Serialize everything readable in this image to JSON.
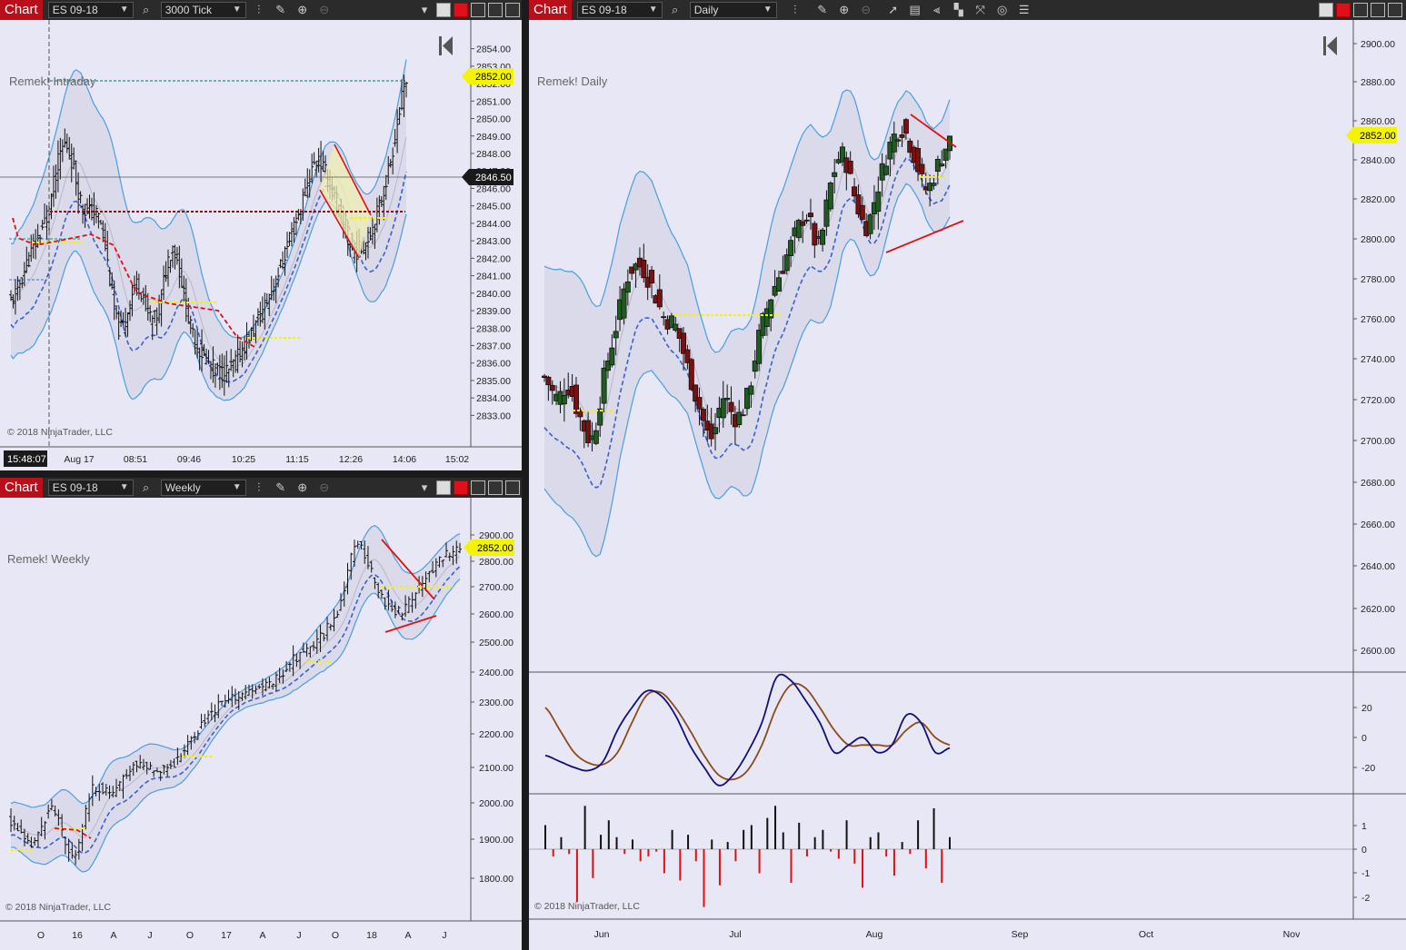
{
  "panels": {
    "intraday": {
      "tag": "Chart",
      "instrument": "ES 09-18",
      "period": "3000 Tick",
      "label": "Remek! Intraday",
      "copyright": "© 2018 NinjaTrader, LLC",
      "time_box": "15:48:07",
      "price_tag": "2852.00",
      "crosshair_tag": "2846.50",
      "x_labels": [
        "Aug 17",
        "08:51",
        "09:46",
        "10:25",
        "11:15",
        "12:26",
        "14:06",
        "15:02"
      ],
      "y_labels": [
        "2854.00",
        "2853.00",
        "2852.00",
        "2851.00",
        "2850.00",
        "2849.00",
        "2848.00",
        "2847.00",
        "2846.00",
        "2845.00",
        "2844.00",
        "2843.00",
        "2842.00",
        "2841.00",
        "2840.00",
        "2839.00",
        "2838.00",
        "2837.00",
        "2836.00",
        "2835.00",
        "2834.00",
        "2833.00"
      ]
    },
    "weekly": {
      "tag": "Chart",
      "instrument": "ES 09-18",
      "period": "Weekly",
      "label": "Remek! Weekly",
      "copyright": "© 2018 NinjaTrader, LLC",
      "price_tag": "2852.00",
      "x_labels": [
        "O",
        "16",
        "A",
        "J",
        "O",
        "17",
        "A",
        "J",
        "O",
        "18",
        "A",
        "J"
      ],
      "y_labels": [
        "2900.00",
        "2800.00",
        "2700.00",
        "2600.00",
        "2500.00",
        "2400.00",
        "2300.00",
        "2200.00",
        "2100.00",
        "2000.00",
        "1900.00",
        "1800.00"
      ]
    },
    "daily": {
      "tag": "Chart",
      "instrument": "ES 09-18",
      "period": "Daily",
      "label": "Remek! Daily",
      "copyright": "© 2018 NinjaTrader, LLC",
      "price_tag": "2852.00",
      "x_labels": [
        "Jun",
        "Jul",
        "Aug",
        "Sep",
        "Oct",
        "Nov"
      ],
      "y_labels": [
        "2900.00",
        "2880.00",
        "2860.00",
        "2840.00",
        "2820.00",
        "2800.00",
        "2780.00",
        "2760.00",
        "2740.00",
        "2720.00",
        "2700.00",
        "2680.00",
        "2660.00",
        "2640.00",
        "2620.00",
        "2600.00"
      ],
      "osc_labels": [
        "20",
        "0",
        "-20"
      ],
      "hist_labels": [
        "1",
        "0",
        "-1",
        "-2"
      ]
    }
  },
  "colors": {
    "bg": "#e8e7f5",
    "band": "#d6d5e6",
    "band_line": "#4a9ee0",
    "mid_line": "#3a5fcf",
    "red_line": "#e01010",
    "dark_red": "#8b1010",
    "yellow": "#f4f400",
    "up_candle": "#1f5c1f",
    "down_candle": "#7a1010",
    "teal": "#1d8f8f",
    "osc_fast": "#10107a",
    "osc_slow": "#8b4a1a"
  },
  "chart_data": [
    {
      "type": "candlestick",
      "title": "Remek! Intraday",
      "instrument": "ES 09-18",
      "period": "3000 Tick",
      "x": [
        "Aug 17",
        "08:51",
        "09:46",
        "10:25",
        "11:15",
        "12:26",
        "14:06",
        "15:02"
      ],
      "ylim": [
        2833,
        2854
      ],
      "series": [
        {
          "name": "close",
          "values": [
            2839.5,
            2842.0,
            2844.5,
            2848.5,
            2845.0,
            2844.0,
            2838.0,
            2840.5,
            2838.5,
            2842.5,
            2838.0,
            2836.0,
            2835.5,
            2837.0,
            2839.0,
            2841.5,
            2844.5,
            2847.5,
            2845.5,
            2842.5,
            2843.5,
            2847.0,
            2852.0
          ]
        }
      ],
      "last_price": 2852.0,
      "crosshair_price": 2846.5
    },
    {
      "type": "candlestick",
      "title": "Remek! Daily",
      "instrument": "ES 09-18",
      "period": "Daily",
      "x": [
        "Jun",
        "Jul",
        "Aug",
        "Sep",
        "Oct",
        "Nov"
      ],
      "ylim": [
        2595,
        2905
      ],
      "series": [
        {
          "name": "close",
          "values": [
            2735,
            2725,
            2730,
            2715,
            2705,
            2735,
            2760,
            2785,
            2790,
            2780,
            2765,
            2760,
            2740,
            2720,
            2705,
            2725,
            2715,
            2725,
            2755,
            2775,
            2790,
            2805,
            2815,
            2800,
            2830,
            2845,
            2825,
            2810,
            2830,
            2850,
            2858,
            2845,
            2828,
            2840,
            2852
          ]
        }
      ],
      "last_price": 2852.0
    },
    {
      "type": "line",
      "title": "",
      "ylim": [
        -30,
        30
      ],
      "series": [
        {
          "name": "fast",
          "values": [
            -12,
            -16,
            -20,
            -22,
            -16,
            5,
            20,
            31,
            28,
            15,
            -5,
            -20,
            -32,
            -25,
            -10,
            10,
            40,
            38,
            25,
            10,
            -10,
            -5,
            0,
            -10,
            -5,
            15,
            10,
            -10,
            -7
          ]
        },
        {
          "name": "slow",
          "values": [
            20,
            5,
            -10,
            -17,
            -18,
            -10,
            10,
            28,
            30,
            20,
            5,
            -12,
            -25,
            -28,
            -22,
            -5,
            20,
            35,
            33,
            20,
            5,
            -5,
            -5,
            -5,
            -5,
            5,
            10,
            0,
            -5
          ]
        }
      ]
    },
    {
      "type": "bar",
      "title": "",
      "ylim": [
        -2.3,
        1.7
      ],
      "series": [
        {
          "name": "histogram",
          "values": [
            1.0,
            -0.3,
            0.5,
            -0.2,
            -2.2,
            1.8,
            -1.2,
            0.6,
            1.2,
            0.5,
            -0.2,
            0.4,
            -0.5,
            -0.3,
            -0.1,
            -1.0,
            0.8,
            -1.3,
            0.6,
            -0.5,
            -2.4,
            0.4,
            -1.5,
            0.3,
            -0.5,
            0.8,
            1.0,
            -1.0,
            1.3,
            1.8,
            0.7,
            -1.4,
            1.1,
            -0.3,
            0.5,
            0.8,
            -0.1,
            -0.4,
            1.2,
            -0.6,
            -1.6,
            0.5,
            0.7,
            -0.3,
            -1.1,
            0.3,
            -0.2,
            1.2,
            -0.8,
            1.7,
            -1.4,
            0.5
          ]
        }
      ]
    },
    {
      "type": "candlestick",
      "title": "Remek! Weekly",
      "instrument": "ES 09-18",
      "period": "Weekly",
      "x": [
        "O",
        "16",
        "A",
        "J",
        "O",
        "17",
        "A",
        "J",
        "O",
        "18",
        "A",
        "J"
      ],
      "ylim": [
        1740,
        2920
      ],
      "series": [
        {
          "name": "close",
          "values": [
            1980,
            1900,
            2020,
            1870,
            2080,
            2070,
            2160,
            2150,
            2170,
            2260,
            2340,
            2380,
            2400,
            2440,
            2510,
            2560,
            2660,
            2870,
            2720,
            2650,
            2740,
            2820,
            2852
          ]
        }
      ],
      "last_price": 2852.0
    }
  ]
}
